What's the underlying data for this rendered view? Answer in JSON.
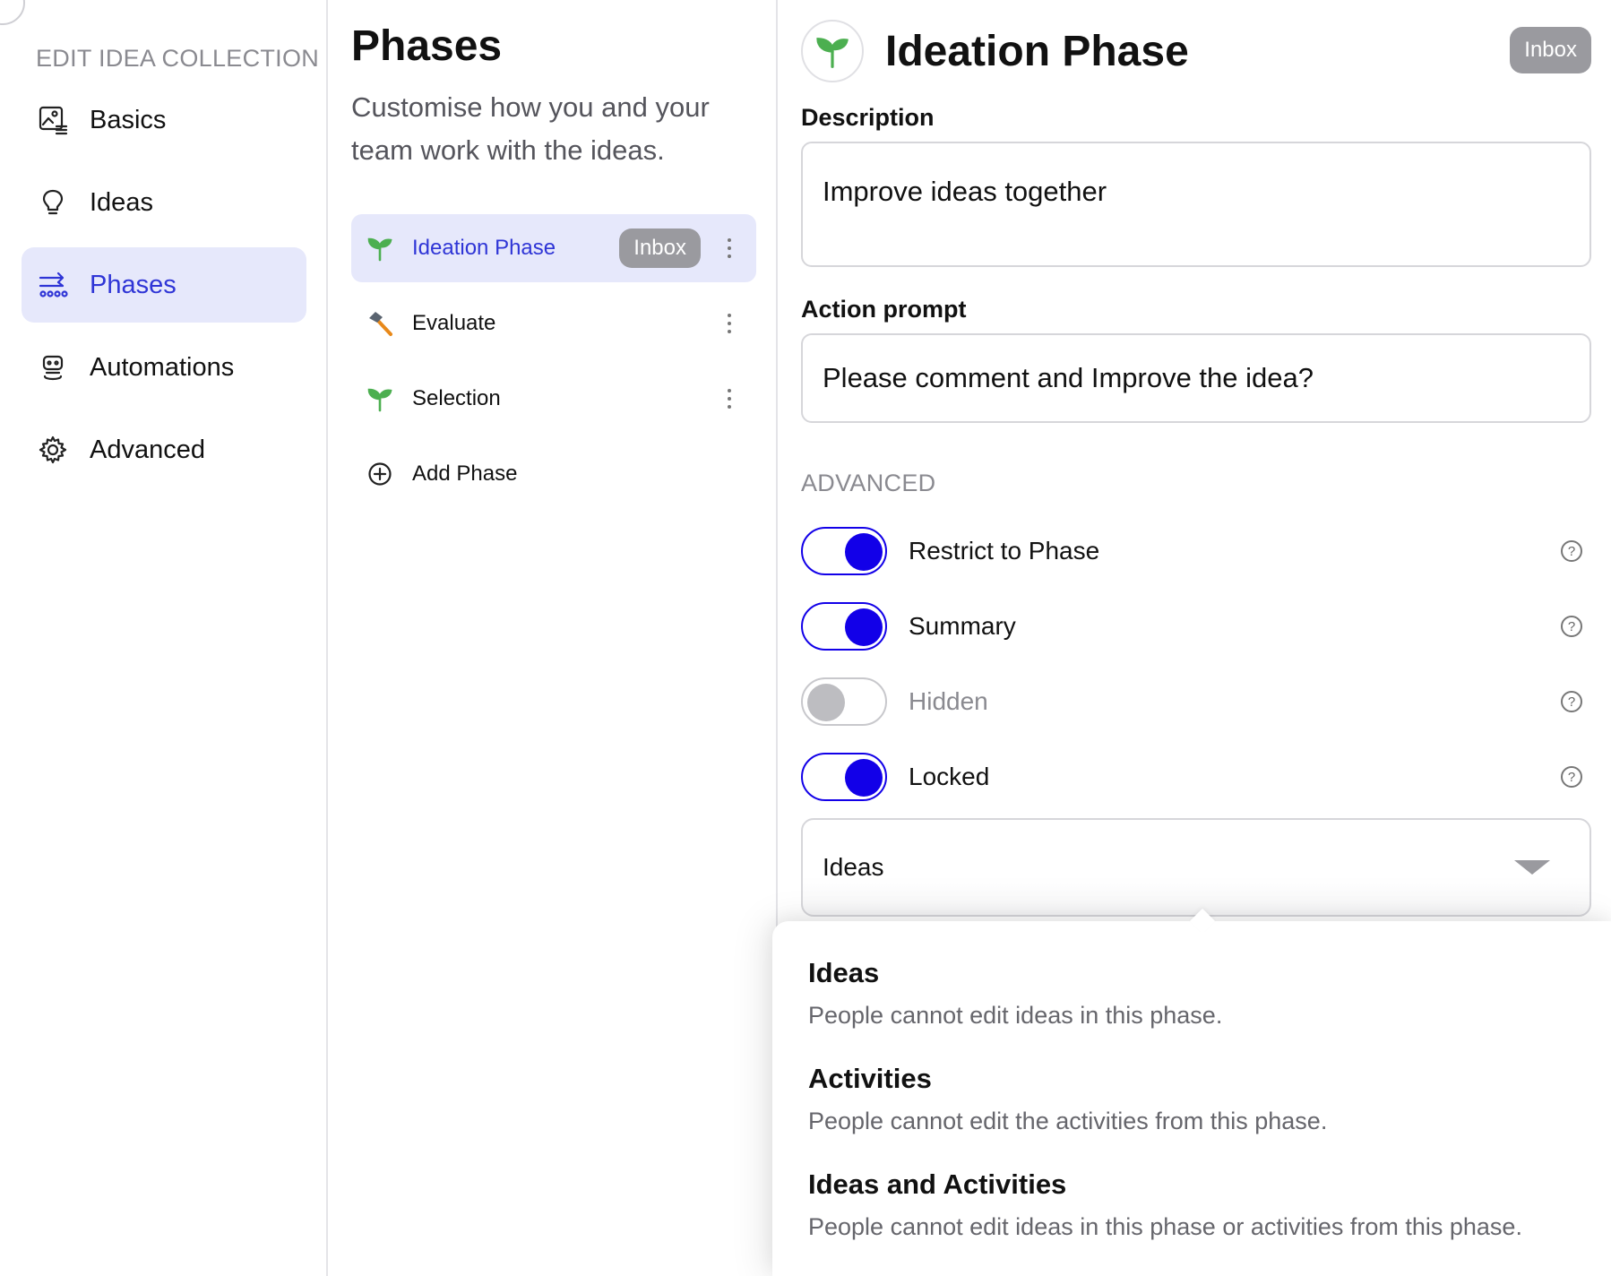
{
  "sidebar": {
    "section_title": "EDIT IDEA COLLECTION",
    "items": [
      {
        "label": "Basics",
        "icon": "image-settings-icon"
      },
      {
        "label": "Ideas",
        "icon": "lightbulb-icon"
      },
      {
        "label": "Phases",
        "icon": "phases-icon",
        "active": true
      },
      {
        "label": "Automations",
        "icon": "robot-icon"
      },
      {
        "label": "Advanced",
        "icon": "gear-icon"
      }
    ]
  },
  "phases": {
    "title": "Phases",
    "subtitle": "Customise how you and your team work with the ideas.",
    "list": [
      {
        "name": "Ideation Phase",
        "badge": "Inbox",
        "icon": "seedling-icon",
        "active": true
      },
      {
        "name": "Evaluate",
        "icon": "hammer-icon"
      },
      {
        "name": "Selection",
        "icon": "seedling-icon"
      }
    ],
    "add_label": "Add Phase"
  },
  "detail": {
    "title": "Ideation Phase",
    "badge": "Inbox",
    "description_label": "Description",
    "description_value": "Improve ideas together",
    "action_prompt_label": "Action prompt",
    "action_prompt_value": "Please comment and Improve the idea?",
    "advanced_title": "ADVANCED",
    "toggles": [
      {
        "label": "Restrict to Phase",
        "on": true
      },
      {
        "label": "Summary",
        "on": true
      },
      {
        "label": "Hidden",
        "on": false
      },
      {
        "label": "Locked",
        "on": true
      }
    ],
    "lock_select_value": "Ideas"
  },
  "dropdown": {
    "options": [
      {
        "name": "Ideas",
        "description": "People cannot edit ideas in this phase."
      },
      {
        "name": "Activities",
        "description": "People cannot edit the activities from this phase."
      },
      {
        "name": "Ideas and Activities",
        "description": "People cannot edit ideas in this phase or activities from this phase."
      }
    ]
  },
  "colors": {
    "accent": "#1200e8",
    "active_bg": "#e6e8fb",
    "active_text": "#2f35d6",
    "badge_bg": "#9a9a9f",
    "seedling_green": "#4caf50",
    "hammer_orange": "#e8891a"
  },
  "help_glyph": "?"
}
